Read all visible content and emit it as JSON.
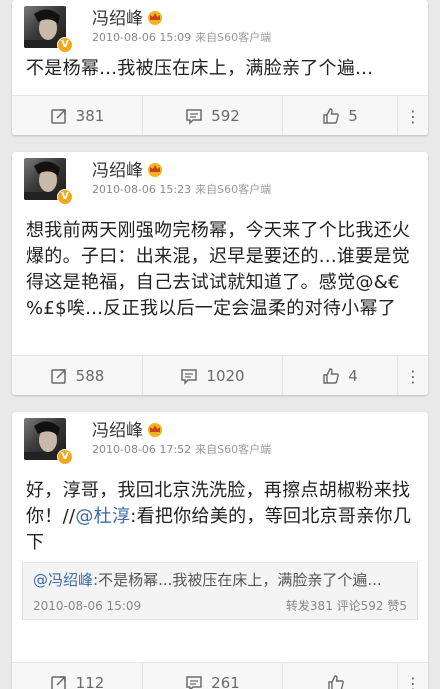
{
  "posts": [
    {
      "author": "冯绍峰",
      "verified": "V",
      "time": "2010-08-06 15:09",
      "source": "来自S60客户端",
      "content": "不是杨幂...我被压在床上，满脸亲了个遍...",
      "reposts": "381",
      "comments": "592",
      "likes": "5",
      "more": "⋮"
    },
    {
      "author": "冯绍峰",
      "verified": "V",
      "time": "2010-08-06 15:23",
      "source": "来自S60客户端",
      "content": "想我前两天刚强吻完杨幂，今天来了个比我还火爆的。子曰：出来混，迟早是要还的...谁要是觉得这是艳福，自己去试试就知道了。感觉@&€%£$唉...反正我以后一定会温柔的对待小幂了",
      "reposts": "588",
      "comments": "1020",
      "likes": "4",
      "more": "⋮"
    },
    {
      "author": "冯绍峰",
      "verified": "V",
      "time": "2010-08-06 17:52",
      "source": "来自S60客户端",
      "content_before": "好，淳哥，我回北京洗洗脸，再擦点胡椒粉来找你！//",
      "content_mention": "@杜淳",
      "content_after": ":看把你给美的，等回北京哥亲你几下",
      "quote": {
        "name": "@冯绍峰",
        "text": ":不是杨幂...我被压在床上，满脸亲了个遍...",
        "time": "2010-08-06 15:09",
        "stats": "转发381  评论592  赞5"
      },
      "reposts": "112",
      "comments": "261",
      "likes": "",
      "more": "⋮"
    }
  ],
  "colors": {
    "background": "#e9e9e9",
    "card": "#ffffff",
    "link": "#3d6aa8",
    "badge": "#f2a81d"
  },
  "icons": [
    "repost-icon",
    "comment-icon",
    "like-icon",
    "more-icon",
    "crown-icon",
    "verified-badge"
  ]
}
